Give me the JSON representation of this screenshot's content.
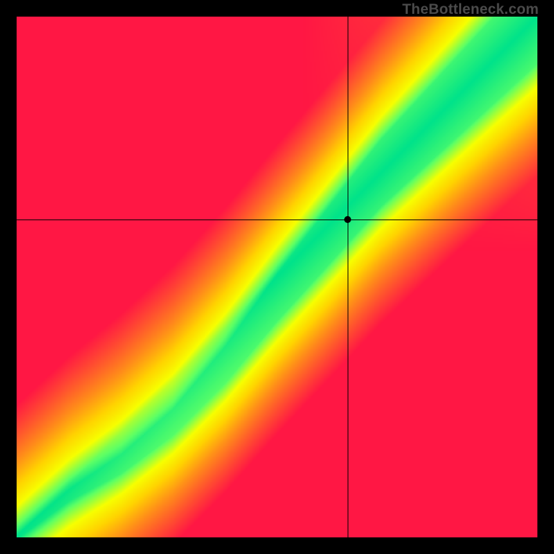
{
  "watermark": "TheBottleneck.com",
  "chart_data": {
    "type": "heatmap",
    "title": "",
    "xlabel": "",
    "ylabel": "",
    "xlim": [
      0,
      100
    ],
    "ylim": [
      0,
      100
    ],
    "grid": false,
    "colormap": {
      "stops": [
        {
          "t": 0.0,
          "color": "#ff1744"
        },
        {
          "t": 0.35,
          "color": "#ff8c1a"
        },
        {
          "t": 0.55,
          "color": "#ffd400"
        },
        {
          "t": 0.72,
          "color": "#f7ff00"
        },
        {
          "t": 0.9,
          "color": "#5cff66"
        },
        {
          "t": 1.0,
          "color": "#00e38a"
        }
      ]
    },
    "optimal_ridge": {
      "description": "green band center y as function of x (normalized 0..1)",
      "points": [
        {
          "x": 0.0,
          "y": 0.0
        },
        {
          "x": 0.1,
          "y": 0.08
        },
        {
          "x": 0.2,
          "y": 0.14
        },
        {
          "x": 0.3,
          "y": 0.22
        },
        {
          "x": 0.4,
          "y": 0.33
        },
        {
          "x": 0.5,
          "y": 0.46
        },
        {
          "x": 0.6,
          "y": 0.58
        },
        {
          "x": 0.7,
          "y": 0.7
        },
        {
          "x": 0.8,
          "y": 0.8
        },
        {
          "x": 0.9,
          "y": 0.9
        },
        {
          "x": 1.0,
          "y": 1.0
        }
      ],
      "band_halfwidth_at": [
        {
          "x": 0.0,
          "w": 0.004
        },
        {
          "x": 0.3,
          "w": 0.025
        },
        {
          "x": 0.6,
          "w": 0.055
        },
        {
          "x": 1.0,
          "w": 0.09
        }
      ]
    },
    "corner_colors": {
      "top_left": "#ff1744",
      "top_right": "#ffd400",
      "bottom_left": "#ff1744",
      "bottom_right": "#ff1744"
    },
    "crosshair": {
      "x": 0.635,
      "y": 0.61
    },
    "marker": {
      "x": 0.635,
      "y": 0.61
    }
  }
}
